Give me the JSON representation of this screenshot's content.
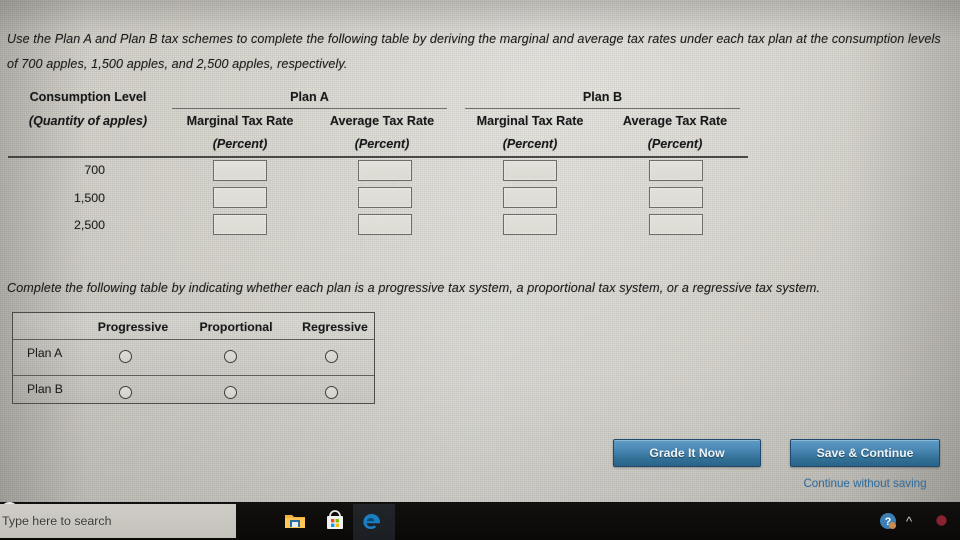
{
  "prompts": {
    "p1": "Use the Plan A and Plan B tax schemes to complete the following table by deriving the marginal and average tax rates under each tax plan at the consumption levels of 700 apples, 1,500 apples, and 2,500 apples, respectively.",
    "p2": "Complete the following table by indicating whether each plan is a progressive tax system, a proportional tax system, or a regressive tax system."
  },
  "rates_table": {
    "col0_header_line1": "Consumption Level",
    "col0_header_line2": "(Quantity of apples)",
    "plans": [
      {
        "name": "Plan A",
        "columns": [
          {
            "title": "Marginal Tax Rate",
            "unit": "(Percent)"
          },
          {
            "title": "Average Tax Rate",
            "unit": "(Percent)"
          }
        ]
      },
      {
        "name": "Plan B",
        "columns": [
          {
            "title": "Marginal Tax Rate",
            "unit": "(Percent)"
          },
          {
            "title": "Average Tax Rate",
            "unit": "(Percent)"
          }
        ]
      }
    ],
    "rows": [
      {
        "label": "700",
        "plan_a_marginal": "",
        "plan_a_average": "",
        "plan_b_marginal": "",
        "plan_b_average": ""
      },
      {
        "label": "1,500",
        "plan_a_marginal": "",
        "plan_a_average": "",
        "plan_b_marginal": "",
        "plan_b_average": ""
      },
      {
        "label": "2,500",
        "plan_a_marginal": "",
        "plan_a_average": "",
        "plan_b_marginal": "",
        "plan_b_average": ""
      }
    ]
  },
  "system_table": {
    "headers": [
      "Progressive",
      "Proportional",
      "Regressive"
    ],
    "rows": [
      {
        "label": "Plan A",
        "selected": null
      },
      {
        "label": "Plan B",
        "selected": null
      }
    ]
  },
  "actions": {
    "grade": "Grade It Now",
    "save": "Save & Continue",
    "continue_without_saving": "Continue without saving"
  },
  "taskbar": {
    "search_placeholder": "Type here to search",
    "icons": [
      "cortana-icon",
      "file-explorer-icon",
      "microsoft-store-icon",
      "edge-icon"
    ],
    "tray": [
      "help-icon",
      "chevron-up-icon",
      "notification-icon"
    ]
  },
  "colors": {
    "button_blue_top": "#5e9cc6",
    "button_blue_bottom": "#2a638a",
    "link_blue": "#2f6ea0",
    "page_bg": "#d2d0c8"
  }
}
